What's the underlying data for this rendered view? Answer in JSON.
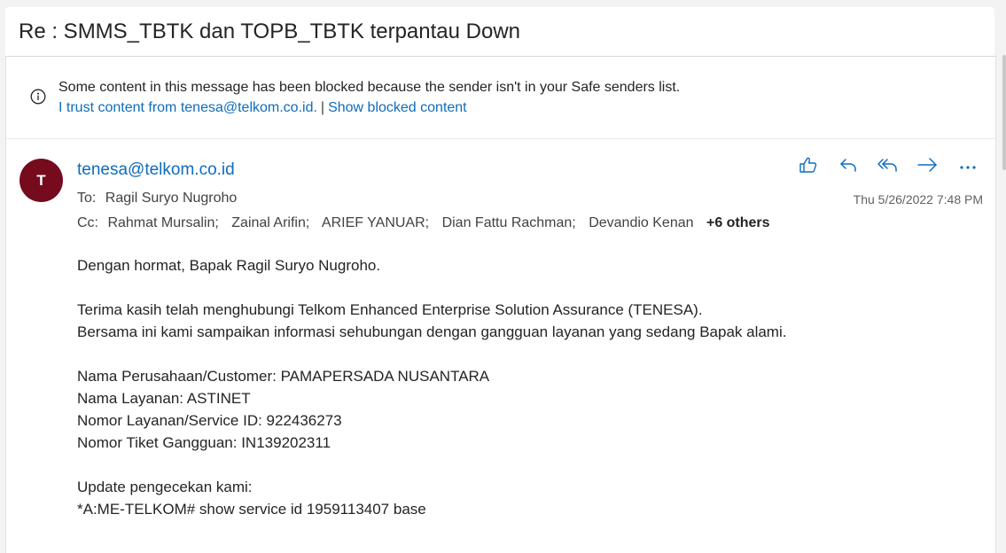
{
  "subject": "Re : SMMS_TBTK dan TOPB_TBTK terpantau Down",
  "infobar": {
    "message": "Some content in this message has been blocked because the sender isn't in your Safe senders list.",
    "trust_link": "I trust content from tenesa@telkom.co.id.",
    "separator": "|",
    "show_link": "Show blocked content"
  },
  "sender": {
    "initial": "T",
    "email": "tenesa@telkom.co.id",
    "avatar_color": "#750b1c"
  },
  "to": {
    "label": "To:",
    "recipients": [
      "Ragil Suryo Nugroho"
    ]
  },
  "cc": {
    "label": "Cc:",
    "recipients": [
      "Rahmat Mursalin;",
      "Zainal Arifin;",
      "ARIEF YANUAR;",
      "Dian Fattu Rachman;",
      "Devandio Kenan"
    ],
    "more": "+6 others"
  },
  "date": "Thu 5/26/2022 7:48 PM",
  "actions": [
    "like-icon",
    "reply-icon",
    "reply-all-icon",
    "forward-icon",
    "more-icon"
  ],
  "body": {
    "greeting": "Dengan hormat, Bapak Ragil Suryo Nugroho.",
    "para1_line1": "Terima kasih telah menghubungi Telkom Enhanced Enterprise Solution Assurance (TENESA).",
    "para1_line2": "Bersama ini kami sampaikan informasi sehubungan dengan gangguan layanan yang sedang Bapak alami.",
    "company": "Nama Perusahaan/Customer: PAMAPERSADA NUSANTARA",
    "service_name": "Nama Layanan: ASTINET",
    "service_id": "Nomor Layanan/Service ID: 922436273",
    "ticket": "Nomor Tiket Gangguan: IN139202311",
    "update_title": "Update pengecekan kami:",
    "command": "*A:ME-TELKOM# show service id 1959113407 base"
  },
  "colors": {
    "accent": "#0f6cbd",
    "background": "#f3f3f3"
  }
}
